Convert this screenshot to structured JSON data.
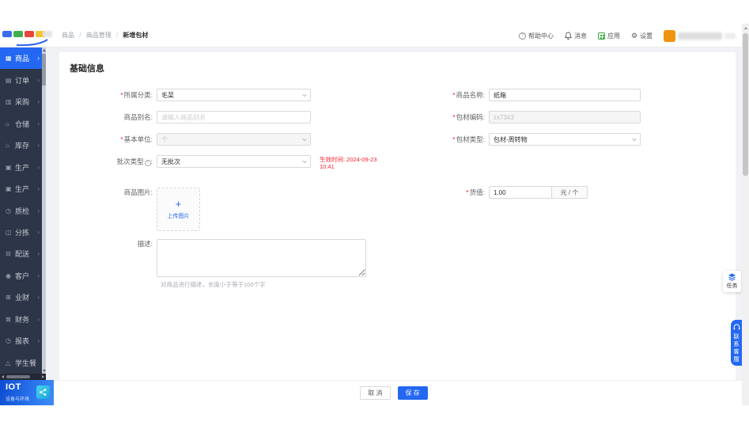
{
  "colors": {
    "primary": "#2468f2",
    "sidebar_bg": "#2d3548",
    "danger": "#f5222d",
    "border": "#d9d9d9",
    "content_bg": "#f0f2f5",
    "brand_green": "#3aa746",
    "avatar_orange": "#f0930f"
  },
  "header": {
    "breadcrumb": [
      {
        "label": "商品"
      },
      {
        "label": "商品管理"
      },
      {
        "label": "新增包材"
      }
    ],
    "separator": "/",
    "actions": {
      "help": "帮助中心",
      "messages": "消息",
      "apps": "应用",
      "settings": "设置"
    }
  },
  "glyphs": {
    "help": "?",
    "gear": "⚙",
    "info": "?",
    "arrow": "›"
  },
  "sidebar": {
    "items": [
      {
        "label": "商品",
        "icon": "▦"
      },
      {
        "label": "订单",
        "icon": "▤"
      },
      {
        "label": "采购",
        "icon": "▥"
      },
      {
        "label": "仓储",
        "icon": "⌂"
      },
      {
        "label": "库存",
        "icon": "⌂"
      },
      {
        "label": "生产",
        "icon": "▣"
      },
      {
        "label": "生产",
        "icon": "▣"
      },
      {
        "label": "质检",
        "icon": "◷"
      },
      {
        "label": "分拣",
        "icon": "◫"
      },
      {
        "label": "配送",
        "icon": "⊟"
      },
      {
        "label": "客户",
        "icon": "◉"
      },
      {
        "label": "业财",
        "icon": "⊞"
      },
      {
        "label": "财务",
        "icon": "⊠"
      },
      {
        "label": "报表",
        "icon": "◷"
      },
      {
        "label": "学生餐",
        "icon": "△"
      }
    ],
    "brand": {
      "title": "IOT",
      "subtitle": "设备与环境"
    }
  },
  "form": {
    "section_title": "基础信息",
    "required_mark": "*",
    "colon": ":",
    "left": {
      "category": {
        "label": "所属分类",
        "value": "毛菜"
      },
      "alias": {
        "label": "商品别名",
        "placeholder": "请输入商品别名"
      },
      "unit": {
        "label": "基本单位",
        "value": "个"
      },
      "batch": {
        "label": "批次类型",
        "value": "无批次",
        "extra_line1": "生效时间: 2024-09-23",
        "extra_line2": "10:41"
      },
      "image": {
        "label": "商品图片",
        "plus": "+",
        "upload_text": "上传图片"
      },
      "desc": {
        "label": "描述",
        "hint": "对商品进行描述，长度小于等于100个字"
      }
    },
    "right": {
      "name": {
        "label": "商品名称",
        "value": "纸箱"
      },
      "code": {
        "label": "包材编码",
        "value": "zx7343"
      },
      "type": {
        "label": "包材类型",
        "value": "包材-周转物"
      },
      "value": {
        "label": "货值",
        "value": "1.00",
        "suffix": "元 / 个"
      }
    }
  },
  "footer": {
    "cancel": "取 消",
    "save": "保 存"
  },
  "floating": {
    "task": "任务",
    "service": "联系客服"
  }
}
